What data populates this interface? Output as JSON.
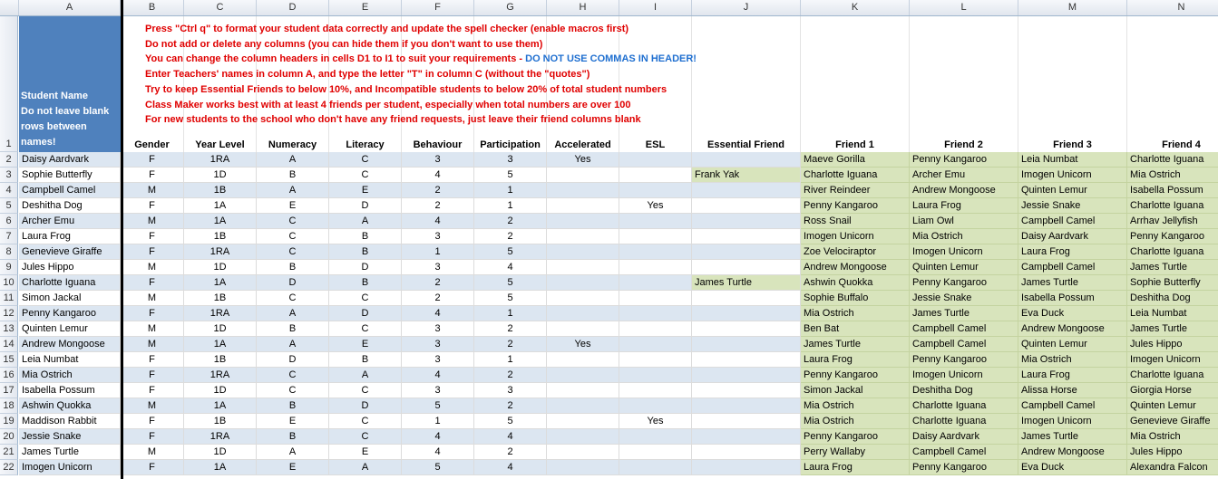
{
  "columns": [
    {
      "key": "row",
      "letter": "",
      "w": 21
    },
    {
      "key": "A",
      "letter": "A",
      "w": 112
    },
    {
      "key": "B",
      "letter": "B",
      "w": 70
    },
    {
      "key": "C",
      "letter": "C",
      "w": 80
    },
    {
      "key": "D",
      "letter": "D",
      "w": 80
    },
    {
      "key": "E",
      "letter": "E",
      "w": 80
    },
    {
      "key": "F",
      "letter": "F",
      "w": 80
    },
    {
      "key": "G",
      "letter": "G",
      "w": 80
    },
    {
      "key": "H",
      "letter": "H",
      "w": 80
    },
    {
      "key": "I",
      "letter": "I",
      "w": 80
    },
    {
      "key": "J",
      "letter": "J",
      "w": 120
    },
    {
      "key": "K",
      "letter": "K",
      "w": 120
    },
    {
      "key": "L",
      "letter": "L",
      "w": 120
    },
    {
      "key": "M",
      "letter": "M",
      "w": 120
    },
    {
      "key": "N",
      "letter": "N",
      "w": 120
    }
  ],
  "a1_lines": [
    "Student Name",
    "Do not leave blank",
    "rows between",
    "names!"
  ],
  "headers": [
    "Gender",
    "Year Level",
    "Numeracy",
    "Literacy",
    "Behaviour",
    "Participation",
    "Accelerated",
    "ESL",
    "Essential Friend",
    "Friend 1",
    "Friend 2",
    "Friend 3",
    "Friend 4"
  ],
  "instructions": [
    {
      "text": "Press \"Ctrl q\" to format your student data correctly and update the spell checker  (enable macros first)",
      "hl": ""
    },
    {
      "text": "Do not add or delete any columns  (you can hide them if you don't  want to use them)",
      "hl": ""
    },
    {
      "text": "You can change the column headers in cells D1 to I1 to suit your requirements - ",
      "hl": "DO NOT USE COMMAS  IN HEADER!"
    },
    {
      "text": "Enter Teachers' names in column  A, and type the letter \"T\" in column  C (without the \"quotes\")",
      "hl": ""
    },
    {
      "text": "Try to keep Essential  Friends to below 10%, and Incompatible  students to below 20% of total student numbers",
      "hl": ""
    },
    {
      "text": "Class Maker  works best with at least 4 friends per student,  especially  when total numbers are over 100",
      "hl": ""
    },
    {
      "text": "For new students to the school  who don't have any friend requests, just leave their friend columns  blank",
      "hl": ""
    }
  ],
  "rows": [
    {
      "n": "2",
      "name": "Daisy Aardvark",
      "g": "F",
      "yl": "1RA",
      "num": "A",
      "lit": "C",
      "beh": "3",
      "par": "3",
      "acc": "Yes",
      "esl": "",
      "ess": "",
      "f1": "Maeve Gorilla",
      "f2": "Penny Kangaroo",
      "f3": "Leia Numbat",
      "f4": "Charlotte Iguana"
    },
    {
      "n": "3",
      "name": "Sophie Butterfly",
      "g": "F",
      "yl": "1D",
      "num": "B",
      "lit": "C",
      "beh": "4",
      "par": "5",
      "acc": "",
      "esl": "",
      "ess": "Frank Yak",
      "f1": "Charlotte Iguana",
      "f2": "Archer Emu",
      "f3": "Imogen Unicorn",
      "f4": "Mia Ostrich"
    },
    {
      "n": "4",
      "name": "Campbell Camel",
      "g": "M",
      "yl": "1B",
      "num": "A",
      "lit": "E",
      "beh": "2",
      "par": "1",
      "acc": "",
      "esl": "",
      "ess": "",
      "f1": "River Reindeer",
      "f2": "Andrew Mongoose",
      "f3": "Quinten Lemur",
      "f4": "Isabella Possum"
    },
    {
      "n": "5",
      "name": "Deshitha Dog",
      "g": "F",
      "yl": "1A",
      "num": "E",
      "lit": "D",
      "beh": "2",
      "par": "1",
      "acc": "",
      "esl": "Yes",
      "ess": "",
      "f1": "Penny Kangaroo",
      "f2": "Laura Frog",
      "f3": "Jessie Snake",
      "f4": "Charlotte Iguana"
    },
    {
      "n": "6",
      "name": "Archer Emu",
      "g": "M",
      "yl": "1A",
      "num": "C",
      "lit": "A",
      "beh": "4",
      "par": "2",
      "acc": "",
      "esl": "",
      "ess": "",
      "f1": "Ross Snail",
      "f2": "Liam Owl",
      "f3": "Campbell Camel",
      "f4": "Arrhav Jellyfish"
    },
    {
      "n": "7",
      "name": "Laura Frog",
      "g": "F",
      "yl": "1B",
      "num": "C",
      "lit": "B",
      "beh": "3",
      "par": "2",
      "acc": "",
      "esl": "",
      "ess": "",
      "f1": "Imogen Unicorn",
      "f2": "Mia Ostrich",
      "f3": "Daisy Aardvark",
      "f4": "Penny Kangaroo"
    },
    {
      "n": "8",
      "name": "Genevieve Giraffe",
      "g": "F",
      "yl": "1RA",
      "num": "C",
      "lit": "B",
      "beh": "1",
      "par": "5",
      "acc": "",
      "esl": "",
      "ess": "",
      "f1": "Zoe Velociraptor",
      "f2": "Imogen Unicorn",
      "f3": "Laura Frog",
      "f4": "Charlotte Iguana"
    },
    {
      "n": "9",
      "name": "Jules Hippo",
      "g": "M",
      "yl": "1D",
      "num": "B",
      "lit": "D",
      "beh": "3",
      "par": "4",
      "acc": "",
      "esl": "",
      "ess": "",
      "f1": "Andrew Mongoose",
      "f2": "Quinten Lemur",
      "f3": "Campbell Camel",
      "f4": "James Turtle"
    },
    {
      "n": "10",
      "name": "Charlotte Iguana",
      "g": "F",
      "yl": "1A",
      "num": "D",
      "lit": "B",
      "beh": "2",
      "par": "5",
      "acc": "",
      "esl": "",
      "ess": "James Turtle",
      "f1": "Ashwin Quokka",
      "f2": "Penny Kangaroo",
      "f3": "James Turtle",
      "f4": "Sophie Butterfly"
    },
    {
      "n": "11",
      "name": "Simon Jackal",
      "g": "M",
      "yl": "1B",
      "num": "C",
      "lit": "C",
      "beh": "2",
      "par": "5",
      "acc": "",
      "esl": "",
      "ess": "",
      "f1": "Sophie Buffalo",
      "f2": "Jessie Snake",
      "f3": "Isabella Possum",
      "f4": "Deshitha Dog"
    },
    {
      "n": "12",
      "name": "Penny Kangaroo",
      "g": "F",
      "yl": "1RA",
      "num": "A",
      "lit": "D",
      "beh": "4",
      "par": "1",
      "acc": "",
      "esl": "",
      "ess": "",
      "f1": "Mia Ostrich",
      "f2": "James Turtle",
      "f3": "Eva Duck",
      "f4": "Leia Numbat"
    },
    {
      "n": "13",
      "name": "Quinten Lemur",
      "g": "M",
      "yl": "1D",
      "num": "B",
      "lit": "C",
      "beh": "3",
      "par": "2",
      "acc": "",
      "esl": "",
      "ess": "",
      "f1": "Ben Bat",
      "f2": "Campbell Camel",
      "f3": "Andrew Mongoose",
      "f4": "James Turtle"
    },
    {
      "n": "14",
      "name": "Andrew Mongoose",
      "g": "M",
      "yl": "1A",
      "num": "A",
      "lit": "E",
      "beh": "3",
      "par": "2",
      "acc": "Yes",
      "esl": "",
      "ess": "",
      "f1": "James Turtle",
      "f2": "Campbell Camel",
      "f3": "Quinten Lemur",
      "f4": "Jules Hippo"
    },
    {
      "n": "15",
      "name": "Leia Numbat",
      "g": "F",
      "yl": "1B",
      "num": "D",
      "lit": "B",
      "beh": "3",
      "par": "1",
      "acc": "",
      "esl": "",
      "ess": "",
      "f1": "Laura Frog",
      "f2": "Penny Kangaroo",
      "f3": "Mia Ostrich",
      "f4": "Imogen Unicorn"
    },
    {
      "n": "16",
      "name": "Mia Ostrich",
      "g": "F",
      "yl": "1RA",
      "num": "C",
      "lit": "A",
      "beh": "4",
      "par": "2",
      "acc": "",
      "esl": "",
      "ess": "",
      "f1": "Penny Kangaroo",
      "f2": "Imogen Unicorn",
      "f3": "Laura Frog",
      "f4": "Charlotte Iguana"
    },
    {
      "n": "17",
      "name": "Isabella Possum",
      "g": "F",
      "yl": "1D",
      "num": "C",
      "lit": "C",
      "beh": "3",
      "par": "3",
      "acc": "",
      "esl": "",
      "ess": "",
      "f1": "Simon Jackal",
      "f2": "Deshitha Dog",
      "f3": "Alissa Horse",
      "f4": "Giorgia Horse"
    },
    {
      "n": "18",
      "name": "Ashwin Quokka",
      "g": "M",
      "yl": "1A",
      "num": "B",
      "lit": "D",
      "beh": "5",
      "par": "2",
      "acc": "",
      "esl": "",
      "ess": "",
      "f1": "Mia Ostrich",
      "f2": "Charlotte Iguana",
      "f3": "Campbell Camel",
      "f4": "Quinten Lemur"
    },
    {
      "n": "19",
      "name": "Maddison Rabbit",
      "g": "F",
      "yl": "1B",
      "num": "E",
      "lit": "C",
      "beh": "1",
      "par": "5",
      "acc": "",
      "esl": "Yes",
      "ess": "",
      "f1": "Mia Ostrich",
      "f2": "Charlotte Iguana",
      "f3": "Imogen Unicorn",
      "f4": "Genevieve Giraffe"
    },
    {
      "n": "20",
      "name": "Jessie Snake",
      "g": "F",
      "yl": "1RA",
      "num": "B",
      "lit": "C",
      "beh": "4",
      "par": "4",
      "acc": "",
      "esl": "",
      "ess": "",
      "f1": "Penny Kangaroo",
      "f2": "Daisy Aardvark",
      "f3": "James Turtle",
      "f4": "Mia Ostrich"
    },
    {
      "n": "21",
      "name": "James Turtle",
      "g": "M",
      "yl": "1D",
      "num": "A",
      "lit": "E",
      "beh": "4",
      "par": "2",
      "acc": "",
      "esl": "",
      "ess": "",
      "f1": "Perry Wallaby",
      "f2": "Campbell Camel",
      "f3": "Andrew Mongoose",
      "f4": "Jules Hippo"
    },
    {
      "n": "22",
      "name": "Imogen Unicorn",
      "g": "F",
      "yl": "1A",
      "num": "E",
      "lit": "A",
      "beh": "5",
      "par": "4",
      "acc": "",
      "esl": "",
      "ess": "",
      "f1": "Laura Frog",
      "f2": "Penny Kangaroo",
      "f3": "Eva Duck",
      "f4": "Alexandra Falcon"
    }
  ],
  "colors": {
    "row_band": "#dce6f1",
    "header_blue": "#4f81bd",
    "friend_green": "#d8e4bc",
    "instruction_red": "#e00000",
    "highlight_blue": "#1f6fd0"
  }
}
